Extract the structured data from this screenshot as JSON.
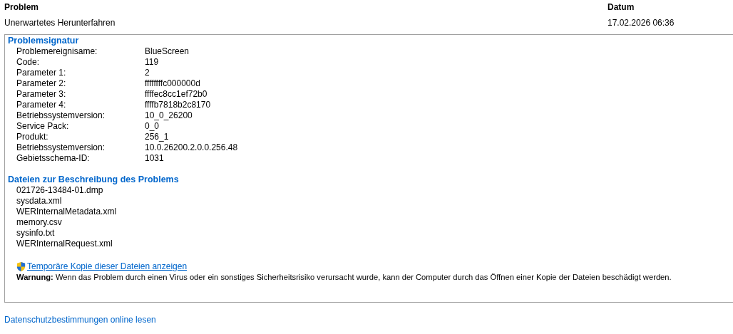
{
  "header": {
    "columns": [
      "Problem",
      "Datum"
    ],
    "values": [
      "Unerwartetes Herunterfahren",
      "17.02.2026 06:36"
    ]
  },
  "details": {
    "signature": {
      "title": "Problemsignatur",
      "rows": [
        {
          "label": "Problemereignisame:",
          "value": "BlueScreen"
        },
        {
          "label": "Code:",
          "value": "119"
        },
        {
          "label": "Parameter 1:",
          "value": "2"
        },
        {
          "label": "Parameter 2:",
          "value": "ffffffffc000000d"
        },
        {
          "label": "Parameter 3:",
          "value": "ffffec8cc1ef72b0"
        },
        {
          "label": "Parameter 4:",
          "value": "ffffb7818b2c8170"
        },
        {
          "label": "Betriebssystemversion:",
          "value": "10_0_26200"
        },
        {
          "label": "Service Pack:",
          "value": "0_0"
        },
        {
          "label": "Produkt:",
          "value": "256_1"
        },
        {
          "label": "Betriebssystemversion:",
          "value": "10.0.26200.2.0.0.256.48"
        },
        {
          "label": "Gebietsschema-ID:",
          "value": "1031"
        }
      ]
    },
    "files": {
      "title": "Dateien zur Beschreibung des Problems",
      "items": [
        "021726-13484-01.dmp",
        "sysdata.xml",
        "WERInternalMetadata.xml",
        "memory.csv",
        "sysinfo.txt",
        "WERInternalRequest.xml"
      ]
    },
    "copy_link": "Temporäre Kopie dieser Dateien anzeigen",
    "warning": "**Warnung:** Wenn das Problem durch einen Virus oder ein sonstiges Sicherheitsrisiko verursacht wurde, kann der Computer durch das Öffnen einer Kopie der Dateien beschädigt werden."
  },
  "privacy_link": "Datenschutzbestimmungen online lesen"
}
